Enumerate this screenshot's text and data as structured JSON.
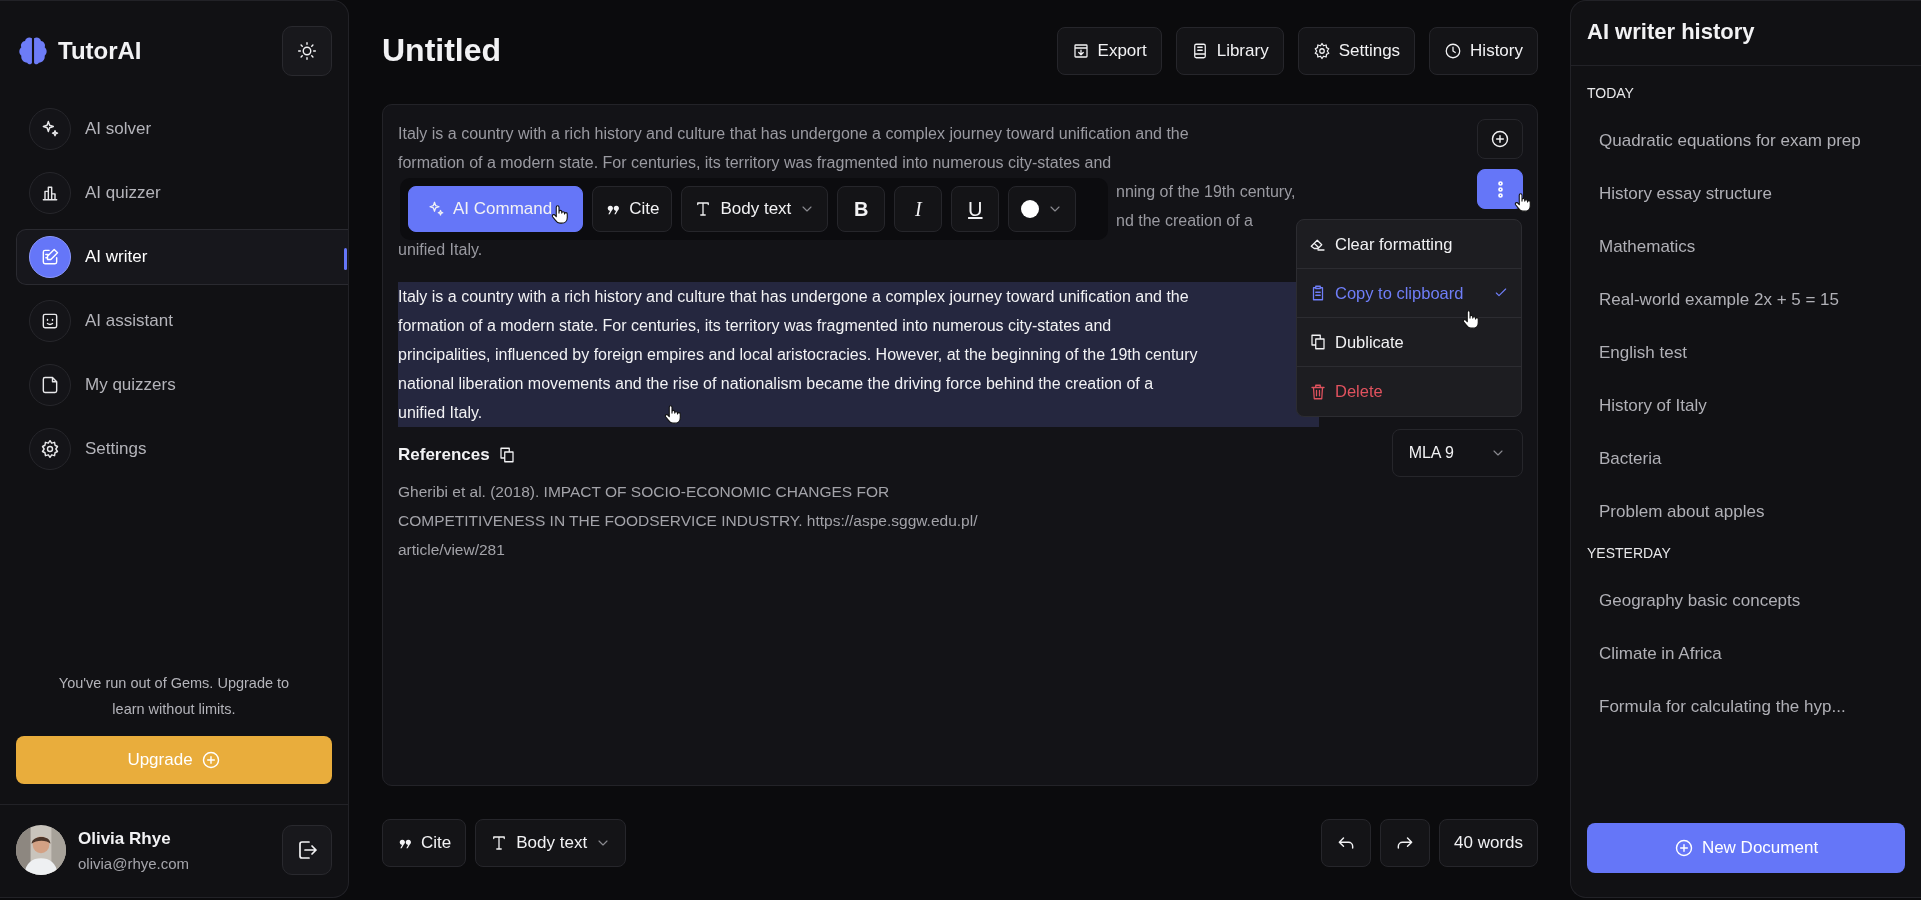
{
  "sidebar": {
    "brand": "TutorAI",
    "nav": [
      {
        "label": "AI solver",
        "selected": false
      },
      {
        "label": "AI quizzer",
        "selected": false
      },
      {
        "label": "AI writer",
        "selected": true
      },
      {
        "label": "AI assistant",
        "selected": false
      },
      {
        "label": "My quizzers",
        "selected": false
      },
      {
        "label": "Settings",
        "selected": false
      }
    ],
    "promo": "You've run out of Gems. Upgrade to learn without limits.",
    "upgrade_button": "Upgrade",
    "user": {
      "name": "Olivia Rhye",
      "email": "olivia@rhye.com"
    }
  },
  "header": {
    "title": "Untitled",
    "actions": [
      "Export",
      "Library",
      "Settings",
      "History"
    ]
  },
  "editor": {
    "paragraphs": [
      {
        "selected": false,
        "lines": [
          {
            "kind": "full",
            "text": "Italy is a country with a rich history and culture that has undergone a complex journey toward unification and the"
          },
          {
            "kind": "full",
            "text": "formation of a modern state. For centuries, its territory was fragmented into numerous city-states and"
          },
          {
            "kind": "partial",
            "text": "nning of the 19th century,"
          },
          {
            "kind": "partial",
            "text": "nd the creation of a"
          },
          {
            "kind": "full",
            "text": "unified Italy."
          }
        ]
      },
      {
        "selected": true,
        "lines": [
          {
            "kind": "full",
            "text": "Italy is a country with a rich history and culture that has undergone a complex journey toward unification and the"
          },
          {
            "kind": "full",
            "text": "formation of a modern state. For centuries, its territory was fragmented into numerous city-states and"
          },
          {
            "kind": "full",
            "text": "principalities, influenced by foreign empires and local aristocracies. However, at the beginning of the 19th century"
          },
          {
            "kind": "full",
            "text": "national liberation movements and the rise of nationalism became the driving force behind the creation of a"
          },
          {
            "kind": "full",
            "text": "unified Italy."
          }
        ]
      }
    ],
    "toolbar": {
      "ai_command": "AI Command",
      "cite": "Cite",
      "style": "Body text",
      "format": [
        {
          "label": "B",
          "kind": "bold"
        },
        {
          "label": "I",
          "kind": "italic"
        },
        {
          "label": "U",
          "kind": "underline"
        }
      ],
      "color": "#ffffff"
    },
    "menu": [
      {
        "label": "Clear formatting",
        "kind": "normal",
        "selected": false
      },
      {
        "label": "Copy to clipboard",
        "kind": "normal",
        "selected": true
      },
      {
        "label": "Dublicate",
        "kind": "normal",
        "selected": false
      },
      {
        "label": "Delete",
        "kind": "danger",
        "selected": false
      }
    ],
    "references": {
      "title": "References",
      "lines": [
        "Gheribi et al. (2018). IMPACT OF SOCIO-ECONOMIC CHANGES FOR",
        "COMPETITIVENESS IN THE FOODSERVICE INDUSTRY. https://aspe.sggw.edu.pl/",
        "article/view/281"
      ],
      "style": "MLA 9"
    }
  },
  "bottom_bar": {
    "cite": "Cite",
    "style": "Body text",
    "word_count": "40 words"
  },
  "history": {
    "title": "AI writer history",
    "groups": [
      {
        "heading": "TODAY",
        "items": [
          "Quadratic equations for exam prep",
          "History essay structure",
          "Mathematics",
          "Real-world example 2x + 5 = 15",
          "English test",
          "History of Italy",
          "Bacteria",
          "Problem about apples"
        ]
      },
      {
        "heading": "YESTERDAY",
        "items": [
          "Geography basic concepts",
          "Climate in Africa",
          "Formula for calculating the hyp..."
        ]
      }
    ],
    "new_button": "New Document"
  }
}
